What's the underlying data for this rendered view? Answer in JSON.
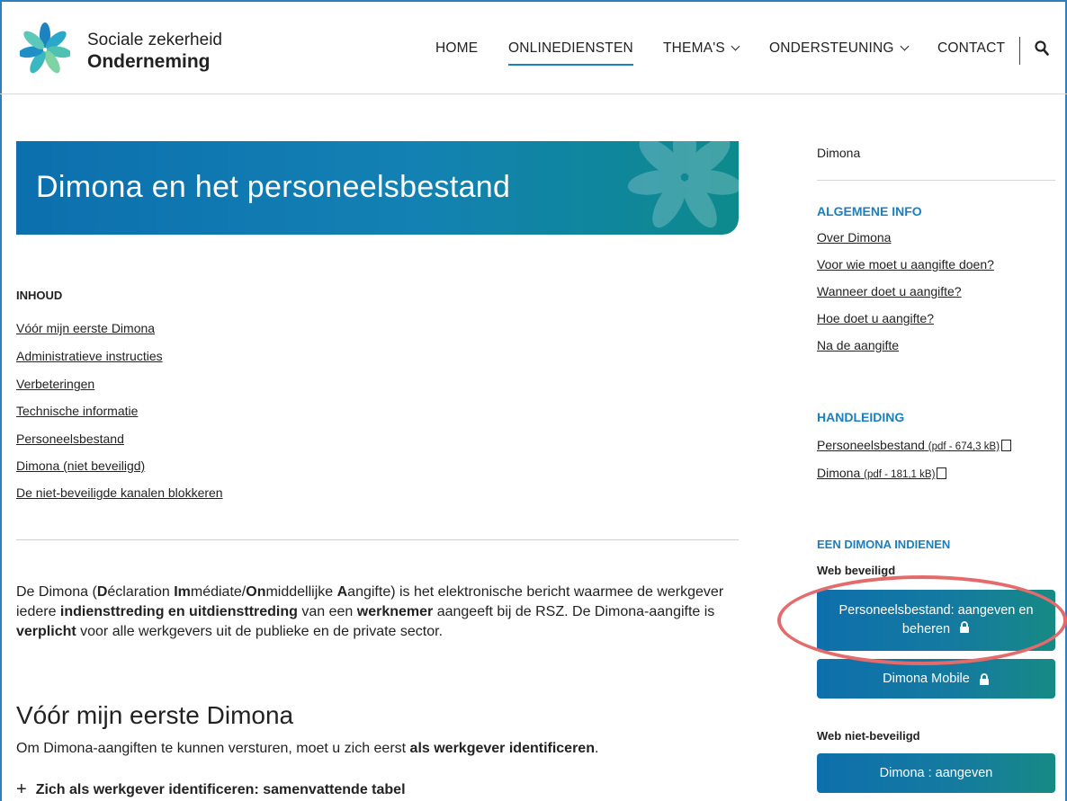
{
  "brand": {
    "line1": "Sociale zekerheid",
    "line2": "Onderneming"
  },
  "nav": {
    "items": [
      {
        "label": "HOME"
      },
      {
        "label": "ONLINEDIENSTEN",
        "active": true
      },
      {
        "label": "THEMA'S"
      },
      {
        "label": "ONDERSTEUNING"
      },
      {
        "label": "CONTACT"
      }
    ],
    "search_icon": "search-icon"
  },
  "hero": {
    "title": "Dimona en het personeelsbestand"
  },
  "content": {
    "inhoud_title": "INHOUD",
    "toc": [
      "Vóór mijn eerste Dimona",
      "Administratieve instructies",
      "Verbeteringen",
      "Technische informatie",
      "Personeelsbestand",
      "Dimona (niet beveiligd)",
      "De niet-beveiligde kanalen blokkeren"
    ],
    "intro": {
      "t1": "De Dimona (",
      "b1": "D",
      "t2": "éclaration ",
      "b2": "Im",
      "t3": "médiate/",
      "b3": "On",
      "t4": "middellijke ",
      "b4": "A",
      "t5": "angifte) is het elektronische bericht waarmee de werkgever iedere ",
      "b5": "indiensttreding en uitdiensttreding",
      "t6": " van een ",
      "b6": "werknemer",
      "t7": " aangeeft bij de RSZ. De Dimona-aangifte is ",
      "b7": "verplicht",
      "t8": " voor alle werkgevers uit de publieke en de private sector."
    },
    "section_title": "Vóór mijn eerste Dimona",
    "section_para": {
      "t1": "Om Dimona-aangiften te kunnen versturen, moet u zich eerst ",
      "b1": "als werkgever identificeren",
      "t2": "."
    },
    "accordion_label": "Zich als werkgever identificeren: samenvattende tabel"
  },
  "sidebar": {
    "title": "Dimona",
    "algemene_info": {
      "heading": "ALGEMENE INFO",
      "links": [
        "Over Dimona",
        "Voor wie moet u aangifte doen?",
        "Wanneer doet u aangifte?",
        "Hoe doet u aangifte?",
        "Na de aangifte"
      ]
    },
    "handleiding": {
      "heading": "HANDLEIDING",
      "links": [
        {
          "label": "Personeelsbestand",
          "meta": "(pdf - 674,3 kB)"
        },
        {
          "label": "Dimona",
          "meta": "(pdf - 181,1 kB)"
        }
      ]
    },
    "indienen": {
      "heading": "EEN DIMONA INDIENEN",
      "web_beveiligd": "Web beveiligd",
      "btn_personeelsbestand": "Personeelsbestand: aangeven en beheren",
      "btn_mobile": "Dimona Mobile",
      "web_niet_beveiligd": "Web niet-beveiligd",
      "btn_aangeven": "Dimona : aangeven"
    }
  },
  "colors": {
    "accent": "#1b7fbd",
    "button_start": "#0e6fac",
    "button_end": "#168a84",
    "highlight": "#e46b6b"
  }
}
